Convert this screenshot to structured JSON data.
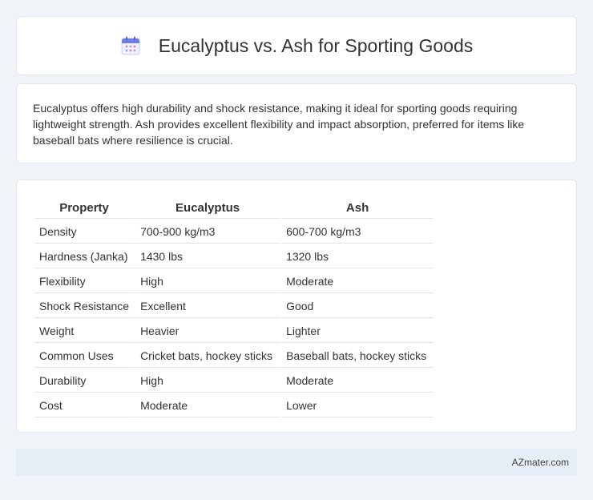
{
  "header": {
    "title": "Eucalyptus vs. Ash for Sporting Goods",
    "icon": "calendar-icon"
  },
  "intro": {
    "text": "Eucalyptus offers high durability and shock resistance, making it ideal for sporting goods requiring lightweight strength. Ash provides excellent flexibility and impact absorption, preferred for items like baseball bats where resilience is crucial."
  },
  "table": {
    "headers": [
      "Property",
      "Eucalyptus",
      "Ash"
    ],
    "rows": [
      [
        "Density",
        "700-900 kg/m3",
        "600-700 kg/m3"
      ],
      [
        "Hardness (Janka)",
        "1430 lbs",
        "1320 lbs"
      ],
      [
        "Flexibility",
        "High",
        "Moderate"
      ],
      [
        "Shock Resistance",
        "Excellent",
        "Good"
      ],
      [
        "Weight",
        "Heavier",
        "Lighter"
      ],
      [
        "Common Uses",
        "Cricket bats, hockey sticks",
        "Baseball bats, hockey sticks"
      ],
      [
        "Durability",
        "High",
        "Moderate"
      ],
      [
        "Cost",
        "Moderate",
        "Lower"
      ]
    ]
  },
  "footer": {
    "brand": "AZmater.com"
  }
}
